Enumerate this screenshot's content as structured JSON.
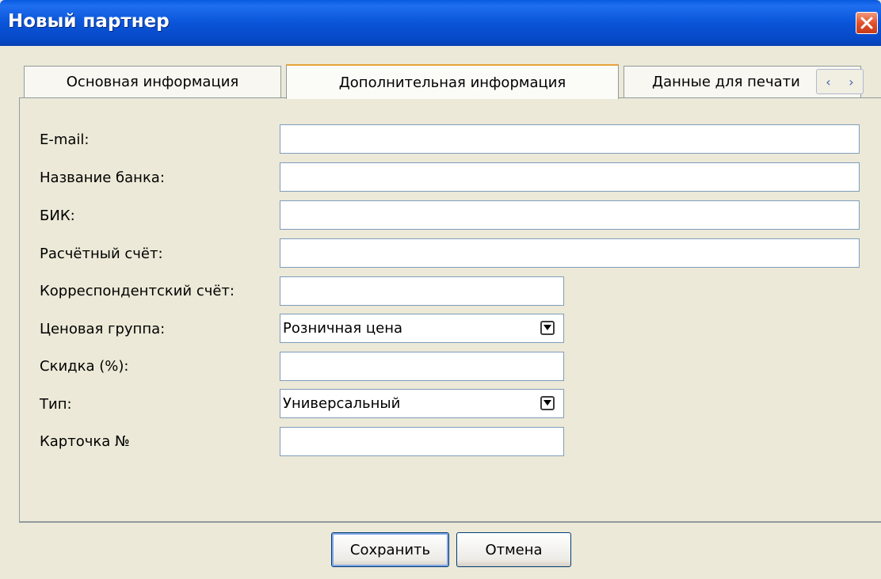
{
  "window": {
    "title": "Новый партнер"
  },
  "tabs": [
    {
      "label": "Основная информация"
    },
    {
      "label": "Дополнительная информация",
      "active": true
    },
    {
      "label": "Данные для печати"
    }
  ],
  "tab_scroll": {
    "left": "‹",
    "right": "›"
  },
  "form": {
    "email": {
      "label": "E-mail:",
      "value": ""
    },
    "bank_name": {
      "label": "Название банка:",
      "value": ""
    },
    "bik": {
      "label": "БИК:",
      "value": ""
    },
    "settlement_account": {
      "label": "Расчётный счёт:",
      "value": ""
    },
    "correspondent_account": {
      "label": "Корреспондентский счёт:",
      "value": ""
    },
    "price_group": {
      "label": "Ценовая группа:",
      "value": "Розничная цена"
    },
    "discount": {
      "label": "Скидка (%):",
      "value": ""
    },
    "type": {
      "label": "Тип:",
      "value": "Универсальный"
    },
    "card_number": {
      "label": "Карточка №",
      "value": ""
    }
  },
  "buttons": {
    "save": "Сохранить",
    "cancel": "Отмена"
  },
  "colors": {
    "title_bar": "#0a54d8",
    "background": "#ece9d8",
    "active_tab_accent": "#e6a43a"
  }
}
